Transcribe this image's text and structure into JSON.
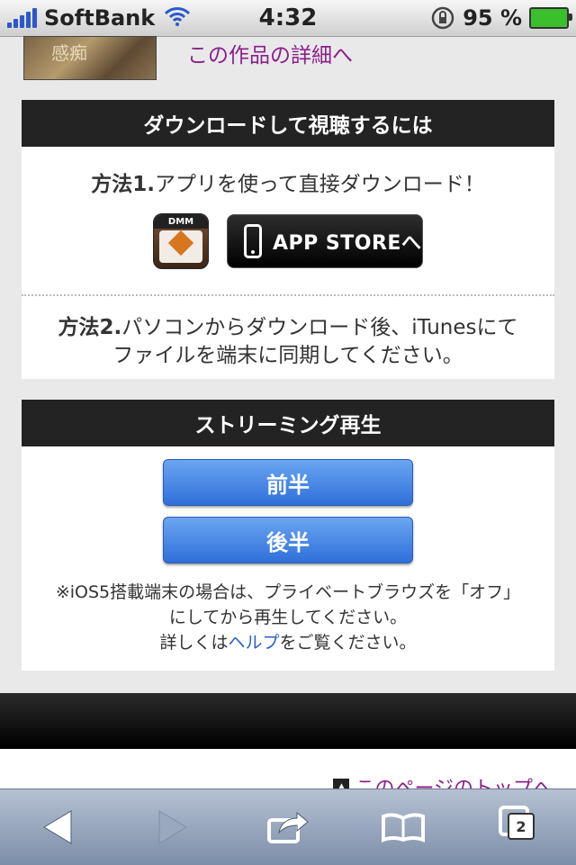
{
  "status_bar": {
    "carrier": "SoftBank",
    "time": "4:32",
    "battery": "95 %"
  },
  "top": {
    "detail_link": "この作品の詳細へ"
  },
  "download_panel": {
    "title": "ダウンロードして視聴するには",
    "method1_label": "方法1.",
    "method1_text": "アプリを使って直接ダウンロード！",
    "dmm_icon_label": "DMM",
    "store_button": "APP STOREへ",
    "method2_label": "方法2.",
    "method2_text_line1": "パソコンからダウンロード後、iTunesにて",
    "method2_text_line2": "ファイルを端末に同期してください。"
  },
  "stream_panel": {
    "title": "ストリーミング再生",
    "first_half": "前半",
    "second_half": "後半",
    "note_line1": "※iOS5搭載端末の場合は、プライベートブラウズを「オフ」",
    "note_line2": "にしてから再生してください。",
    "note_line3_prefix": "詳しくは",
    "note_help_link": "ヘルプ",
    "note_line3_suffix": "をご覧ください。"
  },
  "footer": {
    "page_top_link": "このページのトップへ"
  },
  "toolbar": {
    "tabs_count": "2"
  },
  "colors": {
    "accent_link": "#8b1f8b",
    "help_link": "#2a62c8",
    "button_blue": "#3a7de0",
    "panel_header": "#232323"
  }
}
